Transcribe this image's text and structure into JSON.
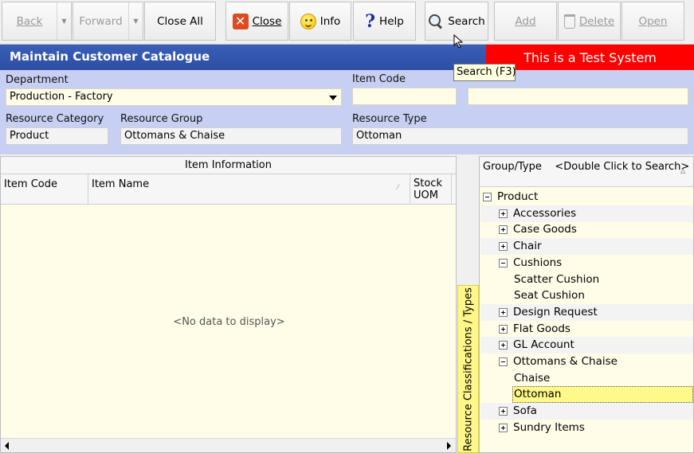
{
  "toolbar": {
    "back": "Back",
    "forward": "Forward",
    "close_all": "Close All",
    "close": "Close",
    "info": "Info",
    "help": "Help",
    "search": "Search",
    "add": "Add",
    "delete": "Delete",
    "open": "Open"
  },
  "header": {
    "title": "Maintain Customer Catalogue",
    "banner": "This is a Test System",
    "banner_color": "#ff0000"
  },
  "tooltip": "Search (F3)",
  "form": {
    "department_label": "Department",
    "department_value": "Production - Factory",
    "item_code_label": "Item Code",
    "item_code_value": "",
    "item_name_value": "",
    "resource_category_label": "Resource Category",
    "resource_category_value": "Product",
    "resource_group_label": "Resource Group",
    "resource_group_value": "Ottomans & Chaise",
    "resource_type_label": "Resource Type",
    "resource_type_value": "Ottoman"
  },
  "grid": {
    "caption": "Item Information",
    "columns": [
      "Item Code",
      "Item Name",
      "Stock\nUOM"
    ],
    "empty_text": "<No data to display>"
  },
  "side_tab": "Resource Classifications / Types",
  "tree": {
    "header": "Group/Type    <Double Click to Search>",
    "items": [
      {
        "label": "Product",
        "level": 0,
        "state": "expanded"
      },
      {
        "label": "Accessories",
        "level": 1,
        "state": "collapsed"
      },
      {
        "label": "Case Goods",
        "level": 1,
        "state": "collapsed"
      },
      {
        "label": "Chair",
        "level": 1,
        "state": "collapsed"
      },
      {
        "label": "Cushions",
        "level": 1,
        "state": "expanded"
      },
      {
        "label": "Scatter Cushion",
        "level": 2,
        "state": "leaf"
      },
      {
        "label": "Seat Cushion",
        "level": 2,
        "state": "leaf"
      },
      {
        "label": "Design Request",
        "level": 1,
        "state": "collapsed"
      },
      {
        "label": "Flat Goods",
        "level": 1,
        "state": "collapsed"
      },
      {
        "label": "GL Account",
        "level": 1,
        "state": "collapsed"
      },
      {
        "label": "Ottomans & Chaise",
        "level": 1,
        "state": "expanded"
      },
      {
        "label": "Chaise",
        "level": 2,
        "state": "leaf"
      },
      {
        "label": "Ottoman",
        "level": 2,
        "state": "leaf",
        "selected": true
      },
      {
        "label": "Sofa",
        "level": 1,
        "state": "collapsed"
      },
      {
        "label": "Sundry Items",
        "level": 1,
        "state": "collapsed"
      }
    ]
  }
}
